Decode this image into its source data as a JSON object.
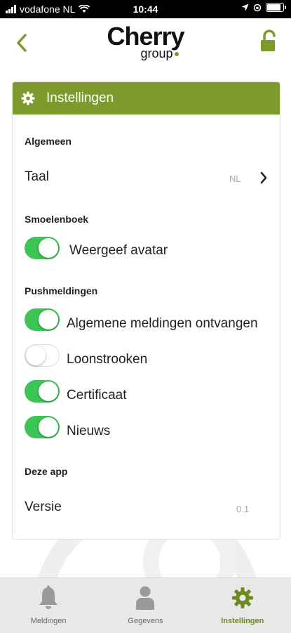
{
  "status_bar": {
    "carrier": "vodafone NL",
    "time": "10:44",
    "battery_level": 0.8
  },
  "header": {
    "brand_main": "Cherry",
    "brand_sub": "group",
    "back_icon": "chevron-left-icon",
    "lock_icon": "unlock-icon",
    "accent": "#7d9a2c"
  },
  "settings": {
    "title": "Instellingen",
    "sections": {
      "general": {
        "title": "Algemeen",
        "language_label": "Taal",
        "language_value": "NL"
      },
      "facebook": {
        "title": "Smoelenboek",
        "avatar_label": "Weergeef avatar",
        "avatar_on": true
      },
      "push": {
        "title": "Pushmeldingen",
        "items": [
          {
            "label": "Algemene meldingen ontvangen",
            "on": true
          },
          {
            "label": "Loonstrooken",
            "on": false
          },
          {
            "label": "Certificaat",
            "on": true
          },
          {
            "label": "Nieuws",
            "on": true
          }
        ]
      },
      "app": {
        "title": "Deze app",
        "version_label": "Versie",
        "version_value": "0.1"
      }
    }
  },
  "tabbar": {
    "tabs": [
      {
        "label": "Meldingen",
        "icon": "bell-icon",
        "active": false
      },
      {
        "label": "Gegevens",
        "icon": "person-icon",
        "active": false
      },
      {
        "label": "Instellingen",
        "icon": "gear-icon",
        "active": true
      }
    ],
    "active_color": "#6d8a22"
  }
}
